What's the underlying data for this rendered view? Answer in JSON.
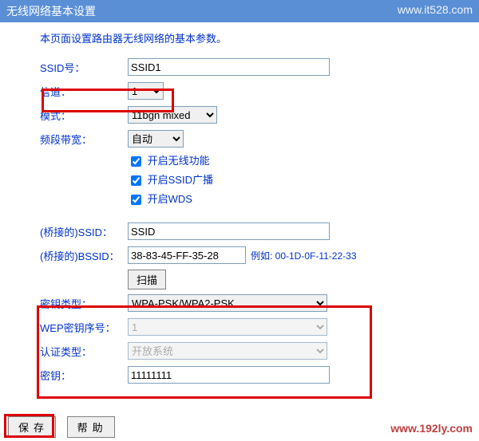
{
  "watermarks": {
    "top": "www.it528.com",
    "bottom": "www.192ly.com"
  },
  "title": "无线网络基本设置",
  "description": "本页面设置路由器无线网络的基本参数。",
  "labels": {
    "ssid": "SSID号：",
    "channel": "信道：",
    "mode": "模式：",
    "bandwidth": "频段带宽：",
    "bridged_ssid": "(桥接的)SSID：",
    "bridged_bssid": "(桥接的)BSSID：",
    "key_type": "密钥类型：",
    "wep_index": "WEP密钥序号：",
    "auth_type": "认证类型：",
    "key": "密钥："
  },
  "values": {
    "ssid": "SSID1",
    "channel": "1",
    "mode": "11bgn mixed",
    "bandwidth": "自动",
    "bridged_ssid": "SSID",
    "bridged_bssid": "38-83-45-FF-35-28",
    "key_type": "WPA-PSK/WPA2-PSK",
    "wep_index": "1",
    "auth_type": "开放系统",
    "key": "11111111"
  },
  "checkboxes": {
    "enable_wireless": "开启无线功能",
    "enable_ssid_broadcast": "开启SSID广播",
    "enable_wds": "开启WDS"
  },
  "hints": {
    "bssid_example": "例如: 00-1D-0F-11-22-33"
  },
  "buttons": {
    "scan": "扫描",
    "save": "保存",
    "help": "帮助"
  }
}
